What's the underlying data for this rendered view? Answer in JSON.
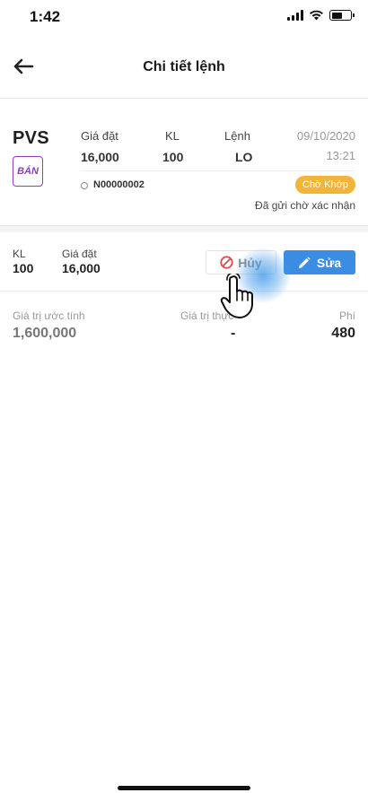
{
  "status_bar": {
    "time": "1:42"
  },
  "header": {
    "title": "Chi tiết lệnh"
  },
  "order": {
    "symbol": "PVS",
    "side": "BÁN",
    "price_label": "Giá đặt",
    "price": "16,000",
    "qty_label": "KL",
    "qty": "100",
    "type_label": "Lệnh",
    "type": "LO",
    "date": "09/10/2020",
    "time": "13:21",
    "order_id": "N00000002",
    "status": "Chờ Khớp",
    "status_note": "Đã gửi chờ xác nhận",
    "colors": {
      "side": "#8e3fb0",
      "status": "#f3b43a"
    }
  },
  "actions": {
    "qty_label": "KL",
    "qty": "100",
    "price_label": "Giá đặt",
    "price": "16,000",
    "cancel_label": "Hủy",
    "edit_label": "Sửa",
    "colors": {
      "cancel_icon": "#d94a4a",
      "edit": "#3b8de4"
    }
  },
  "summary": {
    "estimated_label": "Giá trị ước tính",
    "estimated": "1,600,000",
    "matched_label": "Giá trị thực",
    "matched": "-",
    "fee_label": "Phí",
    "fee": "480"
  }
}
